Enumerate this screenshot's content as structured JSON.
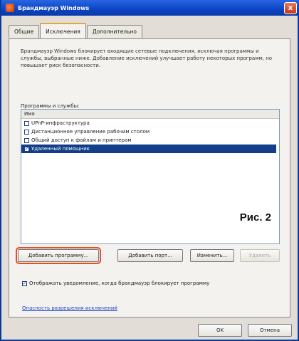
{
  "window": {
    "title": "Брандмауэр Windows",
    "close_label": "x"
  },
  "tabs": [
    {
      "label": "Общие"
    },
    {
      "label": "Исключения"
    },
    {
      "label": "Дополнительно"
    }
  ],
  "description": "Брандмауэр Windows блокирует входящие сетевые подключения, исключая программы и службы, выбранные ниже. Добавление исключений улучшает работу некоторых программ, но повышает риск безопасности.",
  "programs": {
    "label": "Программы и службы:",
    "column_header": "Имя",
    "items": [
      {
        "label": "UPnP-инфраструктура",
        "checked": false
      },
      {
        "label": "Дистанционное управление рабочим столом",
        "checked": false
      },
      {
        "label": "Общий доступ к файлам и принтерам",
        "checked": false
      },
      {
        "label": "Удаленный помощник",
        "checked": true,
        "selected": true
      }
    ]
  },
  "figure_label": "Рис. 2",
  "buttons": {
    "add_program": "Добавить программу...",
    "add_port": "Добавить порт...",
    "edit": "Изменить...",
    "delete": "Удалить"
  },
  "notify": {
    "label": "Отображать уведомление, когда брандмауэр блокирует программу",
    "checked": true
  },
  "link": "Опасность разрешения исключений",
  "footer": {
    "ok": "OK",
    "cancel": "Отмена"
  },
  "colors": {
    "highlight_outline": "#e84d1e",
    "selection": "#123e8a"
  }
}
